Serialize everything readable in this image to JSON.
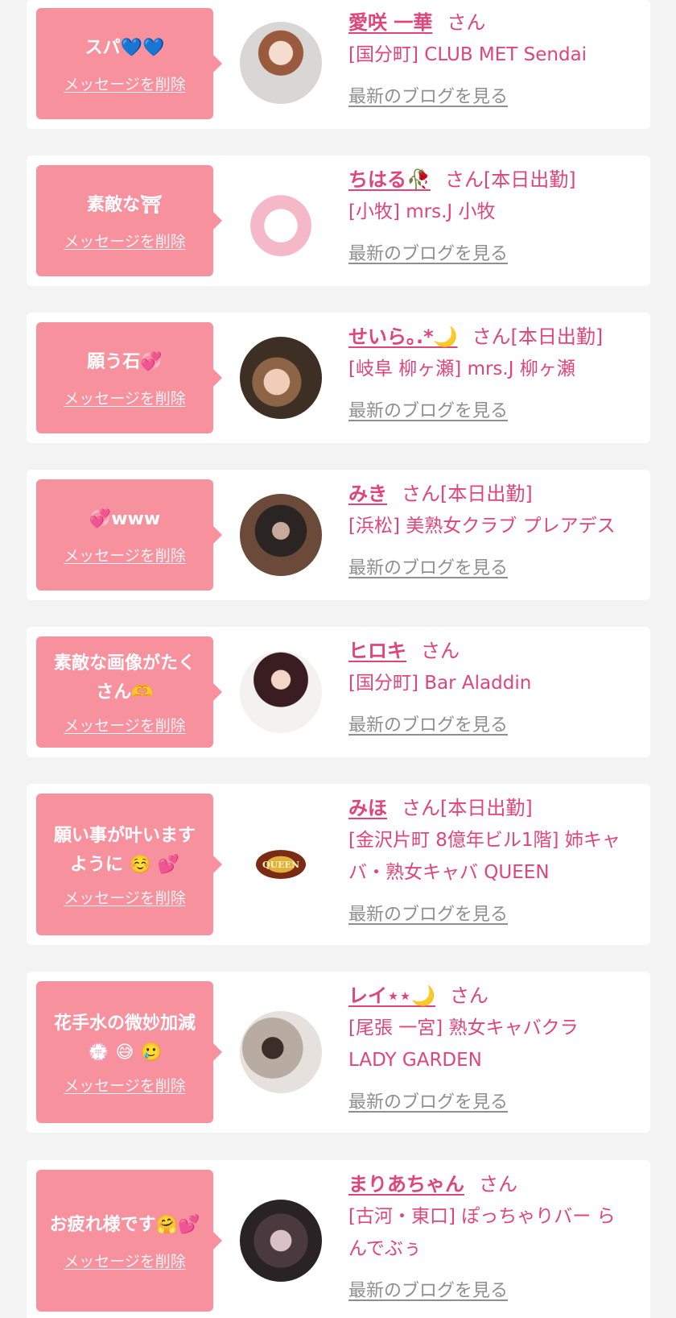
{
  "delete_label": "メッセージを削除",
  "blog_label": "最新のブログを見る",
  "messages": [
    {
      "bubble": [
        "スパ💙💙"
      ],
      "name": "愛咲 一華",
      "suffix": "さん",
      "shop": [
        "[国分町] CLUB MET Sendai"
      ]
    },
    {
      "bubble": [
        "素敵な⛩"
      ],
      "name": "ちはる🥀",
      "suffix": "さん[本日出勤]",
      "shop": [
        "[小牧] mrs.J 小牧"
      ]
    },
    {
      "bubble": [
        "願う石💞"
      ],
      "name": "せいら｡.*🌙",
      "suffix": "さん[本日出勤]",
      "shop": [
        "[岐阜 柳ヶ瀬] mrs.J 柳ヶ瀬"
      ]
    },
    {
      "bubble": [
        "💞www"
      ],
      "name": "みき",
      "suffix": "さん[本日出勤]",
      "shop": [
        "[浜松] 美熟女クラブ プレアデス"
      ]
    },
    {
      "bubble": [
        "素敵な画像がたく",
        "さん🫶"
      ],
      "name": "ヒロキ",
      "suffix": "さん",
      "shop": [
        "[国分町] Bar Aladdin"
      ]
    },
    {
      "bubble": [
        "願い事が叶います",
        "ように ☺️ 💕"
      ],
      "name": "みほ",
      "suffix": "さん[本日出勤]",
      "shop": [
        "[金沢片町 8億年ビル1階] 姉キャ",
        "バ・熟女キャバ QUEEN"
      ],
      "avatar_text": "QUEEN"
    },
    {
      "bubble": [
        "花手水の微妙加減",
        "💮 😅 🥲"
      ],
      "name": "レイ⋆⋆🌙",
      "suffix": "さん",
      "shop": [
        "[尾張 一宮] 熟女キャバクラ",
        "LADY GARDEN"
      ]
    },
    {
      "bubble": [
        "お疲れ様です🤗💕"
      ],
      "name": "まりあちゃん",
      "suffix": "さん",
      "shop": [
        "[古河・東口] ぽっちゃりバー ら",
        "んでぶぅ"
      ]
    }
  ]
}
